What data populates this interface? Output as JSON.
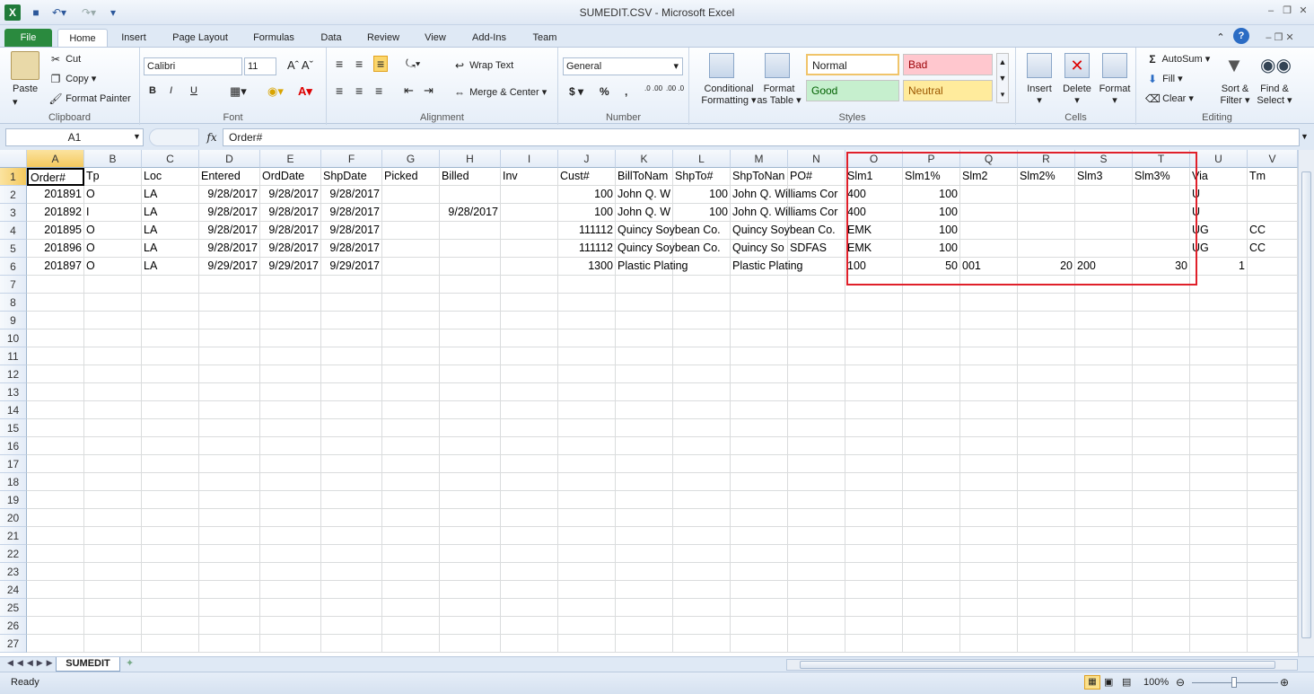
{
  "window": {
    "title": "SUMEDIT.CSV  -  Microsoft Excel"
  },
  "tabs": [
    "File",
    "Home",
    "Insert",
    "Page Layout",
    "Formulas",
    "Data",
    "Review",
    "View",
    "Add-Ins",
    "Team"
  ],
  "clipboard": {
    "paste": "Paste",
    "cut": "Cut",
    "copy": "Copy",
    "format_painter": "Format Painter",
    "label": "Clipboard"
  },
  "font": {
    "name": "Calibri",
    "size": "11",
    "bold": "B",
    "italic": "I",
    "underline": "U",
    "label": "Font"
  },
  "alignment": {
    "wrap": "Wrap Text",
    "merge": "Merge & Center",
    "label": "Alignment"
  },
  "number": {
    "format": "General",
    "currency": "$",
    "percent": "%",
    "comma": ",",
    "inc": ".0 .00",
    "dec": ".00 .0",
    "label": "Number"
  },
  "styles": {
    "conditional": "Conditional",
    "conditional2": "Formatting",
    "format_table": "Format",
    "format_table2": "as Table",
    "normal": "Normal",
    "bad": "Bad",
    "good": "Good",
    "neutral": "Neutral",
    "label": "Styles"
  },
  "cells_group": {
    "insert": "Insert",
    "delete": "Delete",
    "format": "Format",
    "label": "Cells"
  },
  "editing": {
    "autosum": "AutoSum",
    "fill": "Fill",
    "clear": "Clear",
    "sort": "Sort &",
    "sort2": "Filter",
    "find": "Find &",
    "find2": "Select",
    "label": "Editing"
  },
  "formula_bar": {
    "name_box": "A1",
    "fx": "fx",
    "value": "Order#"
  },
  "columns": [
    "A",
    "B",
    "C",
    "D",
    "E",
    "F",
    "G",
    "H",
    "I",
    "J",
    "K",
    "L",
    "M",
    "N",
    "O",
    "P",
    "Q",
    "R",
    "S",
    "T",
    "U",
    "V"
  ],
  "row_numbers": [
    "1",
    "2",
    "3",
    "4",
    "5",
    "6",
    "7",
    "8",
    "9",
    "10",
    "11",
    "12",
    "13",
    "14",
    "15",
    "16",
    "17",
    "18",
    "19",
    "20",
    "21",
    "22",
    "23",
    "24",
    "25",
    "26",
    "27"
  ],
  "rows": [
    [
      "Order#",
      "Tp",
      "Loc",
      "Entered",
      "OrdDate",
      "ShpDate",
      "Picked",
      "Billed",
      "Inv",
      "Cust#",
      "BillToNam",
      "ShpTo#",
      "ShpToNan",
      "PO#",
      "Slm1",
      "Slm1%",
      "Slm2",
      "Slm2%",
      "Slm3",
      "Slm3%",
      "Via",
      "Tm"
    ],
    [
      "201891",
      "O",
      "LA",
      "9/28/2017",
      "9/28/2017",
      "9/28/2017",
      "",
      "",
      "",
      "100",
      "John Q. W",
      "100",
      "John Q. Williams Cor",
      "",
      "400",
      "100",
      "",
      "",
      "",
      "",
      "U",
      ""
    ],
    [
      "201892",
      "I",
      "LA",
      "9/28/2017",
      "9/28/2017",
      "9/28/2017",
      "",
      "9/28/2017",
      "",
      "100",
      "John Q. W",
      "100",
      "John Q. Williams Cor",
      "",
      "400",
      "100",
      "",
      "",
      "",
      "",
      "U",
      ""
    ],
    [
      "201895",
      "O",
      "LA",
      "9/28/2017",
      "9/28/2017",
      "9/28/2017",
      "",
      "",
      "",
      "111112",
      "Quincy Soybean Co.",
      "",
      "Quincy Soybean Co.",
      "",
      "EMK",
      "100",
      "",
      "",
      "",
      "",
      "UG",
      "CC"
    ],
    [
      "201896",
      "O",
      "LA",
      "9/28/2017",
      "9/28/2017",
      "9/28/2017",
      "",
      "",
      "",
      "111112",
      "Quincy Soybean Co.",
      "",
      "Quincy So",
      "SDFAS",
      "EMK",
      "100",
      "",
      "",
      "",
      "",
      "UG",
      "CC"
    ],
    [
      "201897",
      "O",
      "LA",
      "9/29/2017",
      "9/29/2017",
      "9/29/2017",
      "",
      "",
      "",
      "1300",
      "Plastic Plating",
      "",
      "Plastic Plating",
      "",
      "100",
      "50",
      "001",
      "20",
      "200",
      "30",
      "1",
      ""
    ]
  ],
  "sheet_tab": "SUMEDIT",
  "status": {
    "ready": "Ready",
    "zoom": "100%"
  }
}
